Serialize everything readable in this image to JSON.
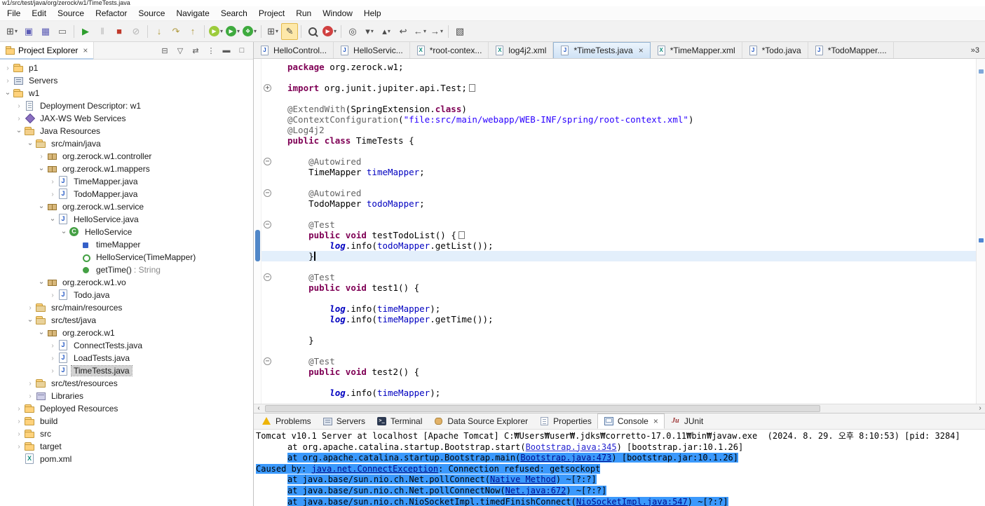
{
  "titlebar": {
    "text": "w1/src/test/java/org/zerock/w1/TimeTests.java"
  },
  "glyphs": {
    "close": "×",
    "dropdown": "▾",
    "expander": "›",
    "fold_plus": "+",
    "fold_minus": "−",
    "scroll_left": "‹",
    "scroll_right": "›"
  },
  "menubar": {
    "items": [
      "File",
      "Edit",
      "Source",
      "Refactor",
      "Source",
      "Navigate",
      "Search",
      "Project",
      "Run",
      "Window",
      "Help"
    ]
  },
  "toolbar": {
    "items": [
      {
        "name": "new-wizard",
        "glyph": "⊞",
        "dd": true
      },
      {
        "name": "save",
        "glyph": "▣",
        "color": "#5b5bb5"
      },
      {
        "name": "save-all",
        "glyph": "▦",
        "color": "#5b5bb5"
      },
      {
        "name": "print",
        "glyph": "▭",
        "color": "#666666"
      },
      {
        "sep": true
      },
      {
        "name": "debug-resume",
        "glyph": "▶",
        "color": "#2e9e2e"
      },
      {
        "name": "debug-suspend",
        "glyph": "‖",
        "color": "#b5b5b5"
      },
      {
        "name": "debug-terminate",
        "glyph": "■",
        "color": "#c0392b"
      },
      {
        "name": "debug-disconnect",
        "glyph": "⊘",
        "color": "#b5b5b5"
      },
      {
        "sep": true
      },
      {
        "name": "step-into",
        "glyph": "↓",
        "color": "#b09a3e"
      },
      {
        "name": "step-over",
        "glyph": "↷",
        "color": "#b09a3e"
      },
      {
        "name": "step-return",
        "glyph": "↑",
        "color": "#b09a3e"
      },
      {
        "sep": true
      },
      {
        "name": "coverage",
        "glyph": "▶",
        "circle": "#9ccb3b",
        "dd": true
      },
      {
        "name": "run",
        "glyph": "▶",
        "circle": "#3eaa3e",
        "dd": true
      },
      {
        "name": "debug",
        "glyph": "❖",
        "circle": "#3eaa3e",
        "dd": true
      },
      {
        "sep": true
      },
      {
        "name": "new-web-wizard",
        "glyph": "⊞",
        "dd": true
      },
      {
        "name": "mark-occurrences",
        "glyph": "✎",
        "active": true
      },
      {
        "sep": true
      },
      {
        "name": "search",
        "glyph": "search"
      },
      {
        "name": "external-tools",
        "glyph": "▶",
        "circle": "#d04040",
        "dd": true
      },
      {
        "sep": true
      },
      {
        "name": "open-type",
        "glyph": "◎"
      },
      {
        "name": "next-annotation",
        "glyph": "▾",
        "dd": true
      },
      {
        "name": "prev-annotation",
        "glyph": "▴",
        "dd": true
      },
      {
        "name": "last-edit-location",
        "glyph": "↩"
      },
      {
        "name": "back",
        "glyph": "←",
        "dd": true
      },
      {
        "name": "forward",
        "glyph": "→",
        "dd": true
      },
      {
        "sep": true
      },
      {
        "name": "open-perspective",
        "glyph": "▧"
      }
    ]
  },
  "explorer": {
    "title": "Project Explorer",
    "header_icons": [
      {
        "name": "collapse-all",
        "glyph": "⊟"
      },
      {
        "name": "filters",
        "glyph": "▽"
      },
      {
        "name": "link-with-editor",
        "glyph": "⇄"
      },
      {
        "name": "view-menu",
        "glyph": "⋮"
      },
      {
        "name": "minimize",
        "glyph": "▬"
      },
      {
        "name": "maximize",
        "glyph": "□"
      }
    ],
    "items": [
      {
        "d": 0,
        "arrow": "closed",
        "icon": "proj",
        "label": "p1"
      },
      {
        "d": 0,
        "arrow": "closed",
        "icon": "servers",
        "label": "Servers"
      },
      {
        "d": 0,
        "arrow": "open",
        "icon": "proj-web",
        "label": "w1"
      },
      {
        "d": 1,
        "arrow": "closed",
        "icon": "descriptor",
        "label": "Deployment Descriptor: w1"
      },
      {
        "d": 1,
        "arrow": "closed",
        "icon": "jaxws",
        "label": "JAX-WS Web Services"
      },
      {
        "d": 1,
        "arrow": "open",
        "icon": "javares",
        "label": "Java Resources"
      },
      {
        "d": 2,
        "arrow": "open",
        "icon": "srcpkg",
        "label": "src/main/java"
      },
      {
        "d": 3,
        "arrow": "closed",
        "icon": "pkg",
        "label": "org.zerock.w1.controller"
      },
      {
        "d": 3,
        "arrow": "open",
        "icon": "pkg",
        "label": "org.zerock.w1.mappers"
      },
      {
        "d": 4,
        "arrow": "closed",
        "icon": "jfile",
        "label": "TimeMapper.java"
      },
      {
        "d": 4,
        "arrow": "closed",
        "icon": "jfile",
        "label": "TodoMapper.java"
      },
      {
        "d": 3,
        "arrow": "open",
        "icon": "pkg",
        "label": "org.zerock.w1.service"
      },
      {
        "d": 4,
        "arrow": "open",
        "icon": "jfile",
        "label": "HelloService.java"
      },
      {
        "d": 5,
        "arrow": "open",
        "icon": "class",
        "label": "HelloService"
      },
      {
        "d": 6,
        "arrow": null,
        "icon": "field",
        "label": "timeMapper"
      },
      {
        "d": 6,
        "arrow": null,
        "icon": "ctor",
        "label": "HelloService(TimeMapper)"
      },
      {
        "d": 6,
        "arrow": null,
        "icon": "method",
        "label": "getTime()",
        "sub": " : String"
      },
      {
        "d": 3,
        "arrow": "open",
        "icon": "pkg",
        "label": "org.zerock.w1.vo"
      },
      {
        "d": 4,
        "arrow": "closed",
        "icon": "jfile",
        "label": "Todo.java"
      },
      {
        "d": 2,
        "arrow": "closed",
        "icon": "srcpkg",
        "label": "src/main/resources"
      },
      {
        "d": 2,
        "arrow": "open",
        "icon": "srcpkg",
        "label": "src/test/java"
      },
      {
        "d": 3,
        "arrow": "open",
        "icon": "pkg",
        "label": "org.zerock.w1"
      },
      {
        "d": 4,
        "arrow": "closed",
        "icon": "jfile",
        "label": "ConnectTests.java"
      },
      {
        "d": 4,
        "arrow": "closed",
        "icon": "jfile",
        "label": "LoadTests.java"
      },
      {
        "d": 4,
        "arrow": "closed",
        "icon": "jfile",
        "label": "TimeTests.java",
        "selected": true
      },
      {
        "d": 2,
        "arrow": "closed",
        "icon": "srcpkg",
        "label": "src/test/resources"
      },
      {
        "d": 2,
        "arrow": "closed",
        "icon": "lib",
        "label": "Libraries"
      },
      {
        "d": 1,
        "arrow": "closed",
        "icon": "folder",
        "label": "Deployed Resources"
      },
      {
        "d": 1,
        "arrow": "closed",
        "icon": "folder",
        "label": "build"
      },
      {
        "d": 1,
        "arrow": "closed",
        "icon": "folder",
        "label": "src"
      },
      {
        "d": 1,
        "arrow": "closed",
        "icon": "folder",
        "label": "target"
      },
      {
        "d": 1,
        "arrow": null,
        "icon": "xmlfile",
        "label": "pom.xml"
      }
    ]
  },
  "editor_tabs": {
    "tabs": [
      {
        "icon": "java",
        "label": "HelloControl..."
      },
      {
        "icon": "java",
        "label": "HelloServic..."
      },
      {
        "icon": "xml",
        "label": "*root-contex..."
      },
      {
        "icon": "xml",
        "label": "log4j2.xml"
      },
      {
        "icon": "java",
        "label": "*TimeTests.java",
        "active": true
      },
      {
        "icon": "xml",
        "label": "*TimeMapper.xml"
      },
      {
        "icon": "java",
        "label": "*Todo.java"
      },
      {
        "icon": "java",
        "label": "*TodoMapper...."
      }
    ],
    "overflow": "»3"
  },
  "editor": {
    "range_marker": {
      "from_line": 16,
      "line_count": 3
    },
    "overview_markers": [
      {
        "top_pct": 3,
        "color": "#7fa8d9"
      },
      {
        "top_pct": 52,
        "color": "#4f86d2"
      }
    ],
    "lines": [
      {
        "segs": [
          [
            "kw",
            "package"
          ],
          [
            "pl",
            " org.zerock.w1;"
          ]
        ]
      },
      {
        "segs": []
      },
      {
        "fold": "plus",
        "segs": [
          [
            "kw",
            "import"
          ],
          [
            "pl",
            " org.junit.jupiter.api.Test;"
          ],
          [
            "fbox",
            ""
          ]
        ]
      },
      {
        "segs": []
      },
      {
        "segs": [
          [
            "ann",
            "@ExtendWith"
          ],
          [
            "pl",
            "(SpringExtension."
          ],
          [
            "kw",
            "class"
          ],
          [
            "pl",
            ")"
          ]
        ]
      },
      {
        "segs": [
          [
            "ann",
            "@ContextConfiguration"
          ],
          [
            "pl",
            "("
          ],
          [
            "str",
            "\"file:src/main/webapp/WEB-INF/spring/root-context.xml\""
          ],
          [
            "pl",
            ")"
          ]
        ]
      },
      {
        "segs": [
          [
            "ann",
            "@Log4j2"
          ]
        ]
      },
      {
        "segs": [
          [
            "kw",
            "public"
          ],
          [
            "pl",
            " "
          ],
          [
            "kw",
            "class"
          ],
          [
            "pl",
            " TimeTests {"
          ]
        ]
      },
      {
        "segs": []
      },
      {
        "fold": "minus",
        "segs": [
          [
            "pl",
            "    "
          ],
          [
            "ann",
            "@Autowired"
          ]
        ]
      },
      {
        "segs": [
          [
            "pl",
            "    TimeMapper "
          ],
          [
            "fld",
            "timeMapper"
          ],
          [
            "pl",
            ";"
          ]
        ]
      },
      {
        "segs": []
      },
      {
        "fold": "minus",
        "segs": [
          [
            "pl",
            "    "
          ],
          [
            "ann",
            "@Autowired"
          ]
        ]
      },
      {
        "segs": [
          [
            "pl",
            "    TodoMapper "
          ],
          [
            "fld",
            "todoMapper"
          ],
          [
            "pl",
            ";"
          ]
        ]
      },
      {
        "segs": []
      },
      {
        "fold": "minus",
        "segs": [
          [
            "pl",
            "    "
          ],
          [
            "ann",
            "@Test"
          ]
        ]
      },
      {
        "segs": [
          [
            "pl",
            "    "
          ],
          [
            "kw",
            "public"
          ],
          [
            "pl",
            " "
          ],
          [
            "kw",
            "void"
          ],
          [
            "pl",
            " testTodoList() {"
          ],
          [
            "fbox",
            ""
          ]
        ]
      },
      {
        "segs": [
          [
            "pl",
            "        "
          ],
          [
            "sf",
            "log"
          ],
          [
            "pl",
            ".info("
          ],
          [
            "fld",
            "todoMapper"
          ],
          [
            "pl",
            ".getList());"
          ]
        ]
      },
      {
        "cur": true,
        "segs": [
          [
            "pl",
            "    }"
          ]
        ]
      },
      {
        "segs": []
      },
      {
        "fold": "minus",
        "segs": [
          [
            "pl",
            "    "
          ],
          [
            "ann",
            "@Test"
          ]
        ]
      },
      {
        "segs": [
          [
            "pl",
            "    "
          ],
          [
            "kw",
            "public"
          ],
          [
            "pl",
            " "
          ],
          [
            "kw",
            "void"
          ],
          [
            "pl",
            " test1() {"
          ]
        ]
      },
      {
        "segs": []
      },
      {
        "segs": [
          [
            "pl",
            "        "
          ],
          [
            "sf",
            "log"
          ],
          [
            "pl",
            ".info("
          ],
          [
            "fld",
            "timeMapper"
          ],
          [
            "pl",
            ");"
          ]
        ]
      },
      {
        "segs": [
          [
            "pl",
            "        "
          ],
          [
            "sf",
            "log"
          ],
          [
            "pl",
            ".info("
          ],
          [
            "fld",
            "timeMapper"
          ],
          [
            "pl",
            ".getTime());"
          ]
        ]
      },
      {
        "segs": []
      },
      {
        "segs": [
          [
            "pl",
            "    }"
          ]
        ]
      },
      {
        "segs": []
      },
      {
        "fold": "minus",
        "segs": [
          [
            "pl",
            "    "
          ],
          [
            "ann",
            "@Test"
          ]
        ]
      },
      {
        "segs": [
          [
            "pl",
            "    "
          ],
          [
            "kw",
            "public"
          ],
          [
            "pl",
            " "
          ],
          [
            "kw",
            "void"
          ],
          [
            "pl",
            " test2() {"
          ]
        ]
      },
      {
        "segs": []
      },
      {
        "segs": [
          [
            "pl",
            "        "
          ],
          [
            "sf",
            "log"
          ],
          [
            "pl",
            ".info("
          ],
          [
            "fld",
            "timeMapper"
          ],
          [
            "pl",
            ");"
          ]
        ]
      }
    ]
  },
  "bottom_tabs": [
    {
      "name": "problems",
      "icon": "problems",
      "label": "Problems"
    },
    {
      "name": "servers",
      "icon": "servers",
      "label": "Servers"
    },
    {
      "name": "terminal",
      "icon": "terminal",
      "label": "Terminal"
    },
    {
      "name": "data-source-explorer",
      "icon": "dse",
      "label": "Data Source Explorer"
    },
    {
      "name": "properties",
      "icon": "properties",
      "label": "Properties"
    },
    {
      "name": "console",
      "icon": "console",
      "label": "Console",
      "active": true
    },
    {
      "name": "junit",
      "icon": "junit",
      "label": "JUnit"
    }
  ],
  "console": {
    "lines": [
      {
        "cls": "hdr",
        "segs": [
          [
            "pl",
            "Tomcat v10.1 Server at localhost [Apache Tomcat] C:₩Users₩user₩.jdks₩corretto-17.0.11₩bin₩javaw.exe  (2024. 8. 29. 오후 8:10:53) [pid: 3284]"
          ]
        ]
      },
      {
        "tab": true,
        "segs": [
          [
            "pl",
            "at org.apache.catalina.startup.Bootstrap.start("
          ],
          [
            "lnk",
            "Bootstrap.java:345"
          ],
          [
            "pl",
            ") [bootstrap.jar:10.1.26]"
          ]
        ]
      },
      {
        "tab": true,
        "sel": true,
        "segs": [
          [
            "pl",
            "at org.apache.catalina.startup.Bootstrap.main("
          ],
          [
            "lnk",
            "Bootstrap.java:473"
          ],
          [
            "pl",
            ") [bootstrap.jar:10.1.26]"
          ]
        ]
      },
      {
        "sel": true,
        "segs": [
          [
            "pl",
            "Caused by: "
          ],
          [
            "lnk",
            "java.net.ConnectException"
          ],
          [
            "pl",
            ": Connection refused: getsockopt"
          ]
        ]
      },
      {
        "tab": true,
        "sel": true,
        "segs": [
          [
            "pl",
            "at java.base/sun.nio.ch.Net.pollConnect("
          ],
          [
            "lnk",
            "Native Method"
          ],
          [
            "pl",
            ") ~[?:?]"
          ]
        ]
      },
      {
        "tab": true,
        "sel": true,
        "segs": [
          [
            "pl",
            "at java.base/sun.nio.ch.Net.pollConnectNow("
          ],
          [
            "lnk",
            "Net.java:672"
          ],
          [
            "pl",
            ") ~[?:?]"
          ]
        ]
      },
      {
        "tab": true,
        "sel": true,
        "segs": [
          [
            "pl",
            "at java.base/sun.nio.ch.NioSocketImpl.timedFinishConnect("
          ],
          [
            "lnk",
            "NioSocketImpl.java:547"
          ],
          [
            "pl",
            ") ~[?:?]"
          ]
        ]
      }
    ]
  }
}
